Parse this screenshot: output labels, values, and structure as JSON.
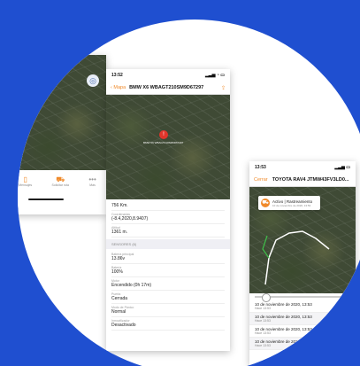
{
  "left_phone": {
    "tabs": [
      {
        "label": "Mensajes",
        "icon": "phone-icon"
      },
      {
        "label": "Solicitar ruta",
        "icon": "truck-icon"
      },
      {
        "label": "Más",
        "icon": "more-icon"
      }
    ],
    "map_button_icon": "locate-icon"
  },
  "middle_phone": {
    "status_time": "13:52",
    "back_label": "Mapa",
    "title": "BMW X6 WBAGT210SM9D67297",
    "map_pin_label": "BMW X6 WBAGT210SM9D67297",
    "rows": [
      {
        "label": "",
        "value": "756 Km."
      },
      {
        "label": "Coordenadas",
        "value": "(-8.4,2020,8.9407)"
      },
      {
        "label": "Altitud",
        "value": "1361 m."
      }
    ],
    "section_title": "SENSORES (6)",
    "sensors": [
      {
        "label": "Batería principal",
        "value": "13.86v"
      },
      {
        "label": "Batería",
        "value": "100%"
      },
      {
        "label": "Motor",
        "value": "Encendido (0h 17m)"
      },
      {
        "label": "Puerta",
        "value": "Cerrada"
      },
      {
        "label": "Modo de Pánico",
        "value": "Normal"
      },
      {
        "label": "Inmovilizador",
        "value": "Desactivado"
      }
    ]
  },
  "right_phone": {
    "status_time": "13:53",
    "close_label": "Cerrar",
    "title": "TOYOTA RAV4 JTMW43FV3LD0...",
    "popup": {
      "title": "Activo | Rastreamiento",
      "subtitle": "10 de noviembre de 2020, 13:53"
    },
    "history": [
      {
        "date": "10 de noviembre de 2020, 13:53",
        "sub": "Hace 13:53"
      },
      {
        "date": "10 de noviembre de 2020, 13:53",
        "sub": "Hace 13:53"
      },
      {
        "date": "10 de noviembre de 2020, 13:53",
        "sub": "Hace 13:53"
      },
      {
        "date": "10 de noviembre de 2020, 13:53",
        "sub": "Hace 13:53"
      }
    ]
  },
  "colors": {
    "background": "#1f4fd0",
    "accent": "#f08a2a",
    "pin": "#e0352b"
  }
}
